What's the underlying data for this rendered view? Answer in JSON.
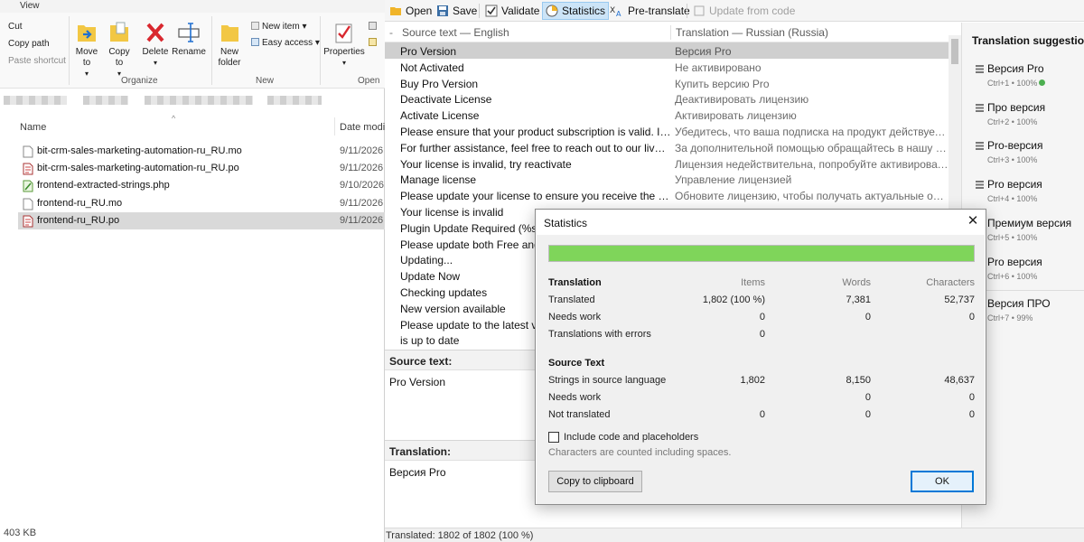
{
  "explorer": {
    "ribbon_tab": "View",
    "clipboard": {
      "cut": "Cut",
      "copy_path": "Copy path",
      "paste_shortcut": "Paste shortcut"
    },
    "organize": {
      "move_to": "Move to",
      "copy_to": "Copy to",
      "delete": "Delete",
      "rename": "Rename",
      "group": "Organize"
    },
    "new": {
      "new_folder": "New folder",
      "new_item": "New item",
      "easy_access": "Easy access",
      "group": "New"
    },
    "open": {
      "properties": "Properties",
      "group": "Open"
    },
    "columns": {
      "name": "Name",
      "date": "Date modified"
    },
    "files": [
      {
        "name": "bit-crm-sales-marketing-automation-ru_RU.mo",
        "date": "9/11/2026",
        "type": "mo"
      },
      {
        "name": "bit-crm-sales-marketing-automation-ru_RU.po",
        "date": "9/11/2026",
        "type": "po"
      },
      {
        "name": "frontend-extracted-strings.php",
        "date": "9/10/2026",
        "type": "php"
      },
      {
        "name": "frontend-ru_RU.mo",
        "date": "9/11/2026",
        "type": "mo"
      },
      {
        "name": "frontend-ru_RU.po",
        "date": "9/11/2026",
        "type": "po",
        "selected": true
      }
    ],
    "status": "403 KB"
  },
  "poedit": {
    "toolbar": {
      "open": "Open",
      "save": "Save",
      "validate": "Validate",
      "statistics": "Statistics",
      "pretranslate": "Pre-translate",
      "update": "Update from code"
    },
    "list_header": {
      "dash": "-",
      "source": "Source text — English",
      "translation": "Translation — Russian (Russia)"
    },
    "rows": [
      {
        "s": "Pro Version",
        "t": "Версия Pro",
        "sel": true
      },
      {
        "s": "Not Activated",
        "t": "Не активировано"
      },
      {
        "s": "Buy Pro Version",
        "t": "Купить версию Pro"
      },
      {
        "s": "Deactivate License",
        "t": "Деактивировать лицензию"
      },
      {
        "s": "Activate License",
        "t": "Активировать лицензию"
      },
      {
        "s": "Please ensure that your product subscription is valid. If needed...",
        "t": "Убедитесь, что ваша подписка на продукт действует. При н..."
      },
      {
        "s": "For further assistance, feel free to reach out to our live support...",
        "t": "За дополнительной помощью обращайтесь в нашу онлай..."
      },
      {
        "s": "Your license is invalid, try reactivate",
        "t": "Лицензия недействительна, попробуйте активировать зан..."
      },
      {
        "s": "Manage license",
        "t": "Управление лицензией"
      },
      {
        "s": "Please update your license to ensure you receive the latest sec...",
        "t": "Обновите лицензию, чтобы получать актуальные обновле..."
      },
      {
        "s": "Your license is invalid",
        "t": ""
      },
      {
        "s": "Plugin Update Required (%s)",
        "t": ""
      },
      {
        "s": "Please update both Free and Pro",
        "t": ""
      },
      {
        "s": "Updating...",
        "t": ""
      },
      {
        "s": "Update Now",
        "t": ""
      },
      {
        "s": "Checking updates",
        "t": ""
      },
      {
        "s": "New version available",
        "t": ""
      },
      {
        "s": "Please update to the latest version",
        "t": ""
      },
      {
        "s": "is up to date",
        "t": ""
      }
    ],
    "source_label": "Source text:",
    "source_text": "Pro Version",
    "translation_label": "Translation:",
    "translation_text": "Версия Pro",
    "status": "Translated: 1802 of 1802 (100 %)",
    "suggestions": {
      "title": "Translation suggestions:",
      "items": [
        {
          "text": "Версия Pro",
          "meta": "Ctrl+1 • 100%",
          "verified": true
        },
        {
          "text": "Про версия",
          "meta": "Ctrl+2 • 100%"
        },
        {
          "text": "Pro-версия",
          "meta": "Ctrl+3 • 100%"
        },
        {
          "text": "Pro версия",
          "meta": "Ctrl+4 • 100%"
        },
        {
          "text": "Премиум версия",
          "meta": "Ctrl+5 • 100%"
        },
        {
          "text": "Pro версия",
          "meta": "Ctrl+6 • 100%"
        },
        {
          "text": "Версия ПРО",
          "meta": "Ctrl+7 • 99%"
        }
      ]
    }
  },
  "statistics": {
    "title": "Statistics",
    "progress": 1.0,
    "progress_color": "#7fd55a",
    "translation_header": "Translation",
    "col_items": "Items",
    "col_words": "Words",
    "col_chars": "Characters",
    "translated_label": "Translated",
    "translated_items": "1,802 (100 %)",
    "translated_words": "7,381",
    "translated_chars": "52,737",
    "needs_work_label": "Needs work",
    "needs_work_items": "0",
    "needs_work_words": "0",
    "needs_work_chars": "0",
    "errors_label": "Translations with errors",
    "errors_items": "0",
    "source_header": "Source Text",
    "strings_label": "Strings in source language",
    "strings_items": "1,802",
    "strings_words": "8,150",
    "strings_chars": "48,637",
    "src_needs_work_label": "Needs work",
    "src_needs_work_words": "0",
    "src_needs_work_chars": "0",
    "not_translated_label": "Not translated",
    "not_translated_items": "0",
    "not_translated_words": "0",
    "not_translated_chars": "0",
    "include_code_label": "Include code and placeholders",
    "chars_note": "Characters are counted including spaces.",
    "copy_button": "Copy to clipboard",
    "ok_button": "OK"
  }
}
